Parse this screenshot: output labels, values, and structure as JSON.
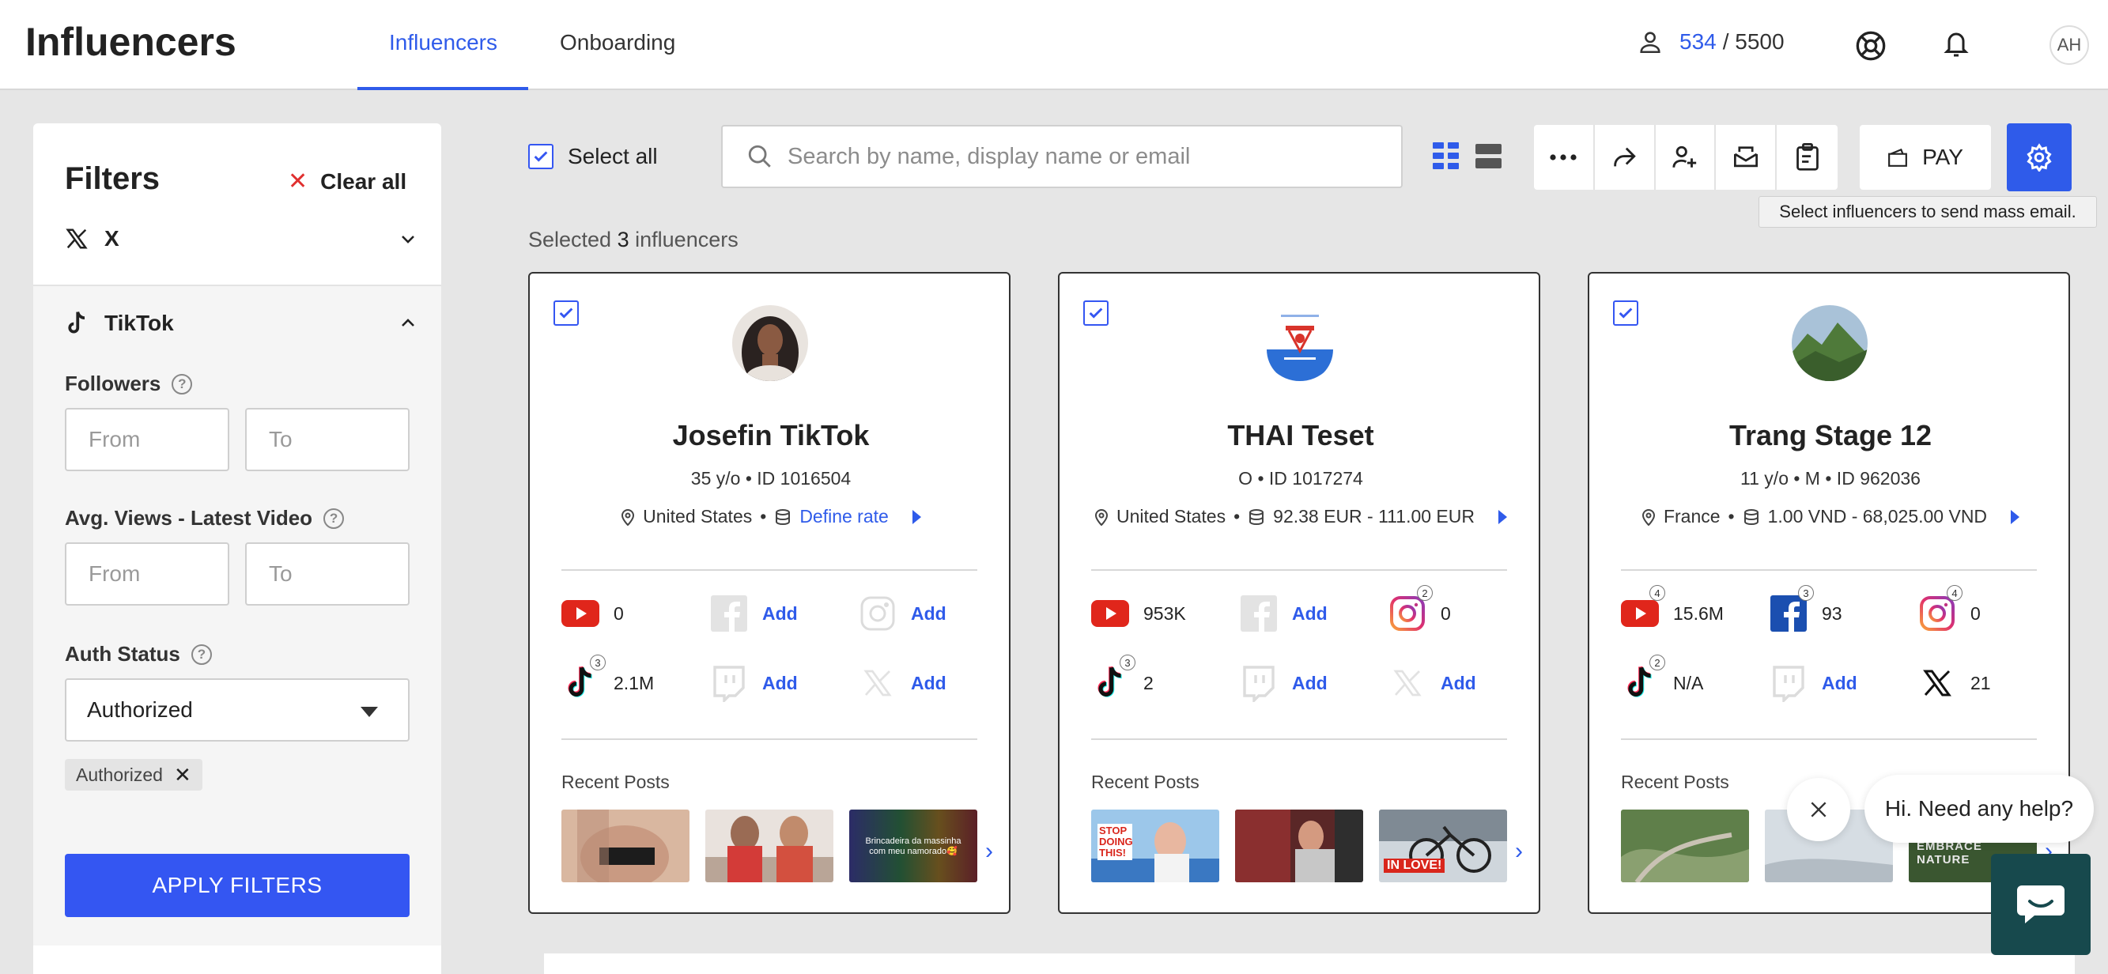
{
  "header": {
    "app_title": "Influencers",
    "tabs": [
      {
        "label": "Influencers"
      },
      {
        "label": "Onboarding"
      }
    ],
    "quota": {
      "used": "534",
      "total": "/ 5500"
    },
    "avatar_initials": "AH"
  },
  "sidebar": {
    "title": "Filters",
    "clear_all": "Clear all",
    "x_platform": "X",
    "tiktok_platform": "TikTok",
    "followers_label": "Followers",
    "avg_views_label": "Avg. Views - Latest Video",
    "auth_status_label": "Auth Status",
    "from_placeholder": "From",
    "to_placeholder": "To",
    "auth_status_value": "Authorized",
    "chip_label": "Authorized",
    "apply_label": "APPLY FILTERS"
  },
  "toolbar": {
    "select_all": "Select all",
    "search_placeholder": "Search by name, display name or email",
    "pay_label": "PAY",
    "tooltip": "Select influencers to send mass email.",
    "selected_prefix": "Selected",
    "selected_count": "3",
    "selected_suffix": "influencers"
  },
  "cards": [
    {
      "name": "Josefin TikTok",
      "meta": "35 y/o • ID 1016504",
      "location": "United States",
      "rate": "Define rate",
      "stats": {
        "youtube": "0",
        "facebook": "Add",
        "instagram": "Add",
        "tiktok": "2.1M",
        "twitch": "Add",
        "x": "Add",
        "tiktok_badge": "3"
      },
      "recent_posts": "Recent Posts",
      "thumb3_caption": "Brincadeira da massinha com meu namorado🥰"
    },
    {
      "name": "THAI Teset",
      "meta": "O • ID 1017274",
      "location": "United States",
      "rate": "92.38 EUR - 111.00 EUR",
      "stats": {
        "youtube": "953K",
        "facebook": "Add",
        "instagram": "0",
        "tiktok": "2",
        "twitch": "Add",
        "x": "Add",
        "instagram_badge": "2",
        "tiktok_badge": "3"
      },
      "recent_posts": "Recent Posts",
      "thumb1_caption": "STOP DOING THIS!",
      "thumb3_caption": "IN LOVE!"
    },
    {
      "name": "Trang Stage 12",
      "meta": "11 y/o • M • ID 962036",
      "location": "France",
      "rate": "1.00 VND - 68,025.00 VND",
      "stats": {
        "youtube": "15.6M",
        "facebook": "93",
        "instagram": "0",
        "tiktok": "N/A",
        "twitch": "Add",
        "x": "21",
        "youtube_badge": "4",
        "facebook_badge": "3",
        "instagram_badge": "4",
        "tiktok_badge": "2"
      },
      "recent_posts": "Recent Posts",
      "thumb3_caption": "EMBRACE NATURE"
    }
  ],
  "help_widget": {
    "message": "Hi. Need any help?"
  },
  "colors": {
    "accent": "#2f5bea",
    "apply": "#3456f2",
    "chat": "#17494d",
    "youtube": "#e0261b"
  }
}
